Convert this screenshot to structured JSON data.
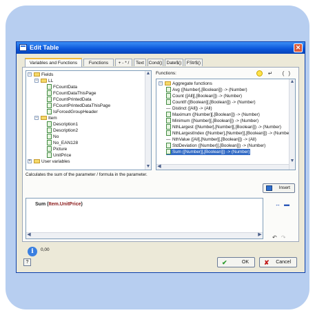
{
  "window": {
    "title": "Edit Table",
    "close_glyph": "✕"
  },
  "tabs": [
    {
      "label": "Variables and Functions"
    },
    {
      "label": "Functions"
    },
    {
      "label": "+ - * /"
    },
    {
      "label": "Text"
    },
    {
      "label": "Cond()"
    },
    {
      "label": "Date$()"
    },
    {
      "label": "FStr$()"
    }
  ],
  "tree": {
    "items": [
      {
        "label": "Fields",
        "icon": "folder-icon"
      },
      {
        "label": "LL",
        "icon": "folder-icon"
      },
      {
        "label": "FCountData",
        "icon": "field-icon"
      },
      {
        "label": "FCountDataThisPage",
        "icon": "field-icon"
      },
      {
        "label": "FCountPrintedData",
        "icon": "field-icon"
      },
      {
        "label": "FCountPrintedDataThisPage",
        "icon": "field-icon"
      },
      {
        "label": "IsForcedGroupHeader",
        "icon": "checkbox-field-icon"
      },
      {
        "label": "Item",
        "icon": "folder-icon"
      },
      {
        "label": "Description1",
        "icon": "text-field-icon"
      },
      {
        "label": "Description2",
        "icon": "text-field-icon"
      },
      {
        "label": "No",
        "icon": "text-field-icon"
      },
      {
        "label": "No_EAN128",
        "icon": "barcode-field-icon"
      },
      {
        "label": "Picture",
        "icon": "picture-field-icon"
      },
      {
        "label": "UnitPrice",
        "icon": "number-field-icon"
      },
      {
        "label": "User variables",
        "icon": "user-variables-icon"
      }
    ]
  },
  "functions": {
    "label": "Functions:",
    "group": "Aggregate functions",
    "items": [
      {
        "label": "Avg ([Number],[Boolean]]) -> (Number)"
      },
      {
        "label": "Count ([All][,[Boolean]]) -> (Number)"
      },
      {
        "label": "CountIf ([Boolean][,[Boolean]]) -> (Number)"
      },
      {
        "label": "Distinct ([All]) -> (All)"
      },
      {
        "label": "Maximum ([Number][,[Boolean]]) -> (Number)"
      },
      {
        "label": "Minimum ([Number][,[Boolean]]) -> (Number)"
      },
      {
        "label": "NthLargest ([Number],[Number][,[Boolean]]) -> (Number)"
      },
      {
        "label": "NthLargestIndex ([Number],[Number][,[Boolean]]) -> (Number)"
      },
      {
        "label": "NthValue ([All],[Number][,[Boolean]]) -> (All)"
      },
      {
        "label": "StdDeviation ([Number][,[Boolean]]) -> (Number)"
      },
      {
        "label": "Sum ([Number][,[Boolean]]) -> (Number)"
      }
    ],
    "selected_index": 10
  },
  "description": "Calculates the sum of the parameter / formula in the parameter.",
  "insert_label": "Insert",
  "formula": {
    "func": "Sum",
    "open": " (",
    "arg": "Item.UnitPrice",
    "close": ")"
  },
  "result": "0,00",
  "buttons": {
    "ok": "OK",
    "cancel": "Cancel",
    "help": "?"
  },
  "colors": {
    "accent": "#0a55da",
    "selection": "#316ac5",
    "background_panel": "#b7cef0"
  }
}
